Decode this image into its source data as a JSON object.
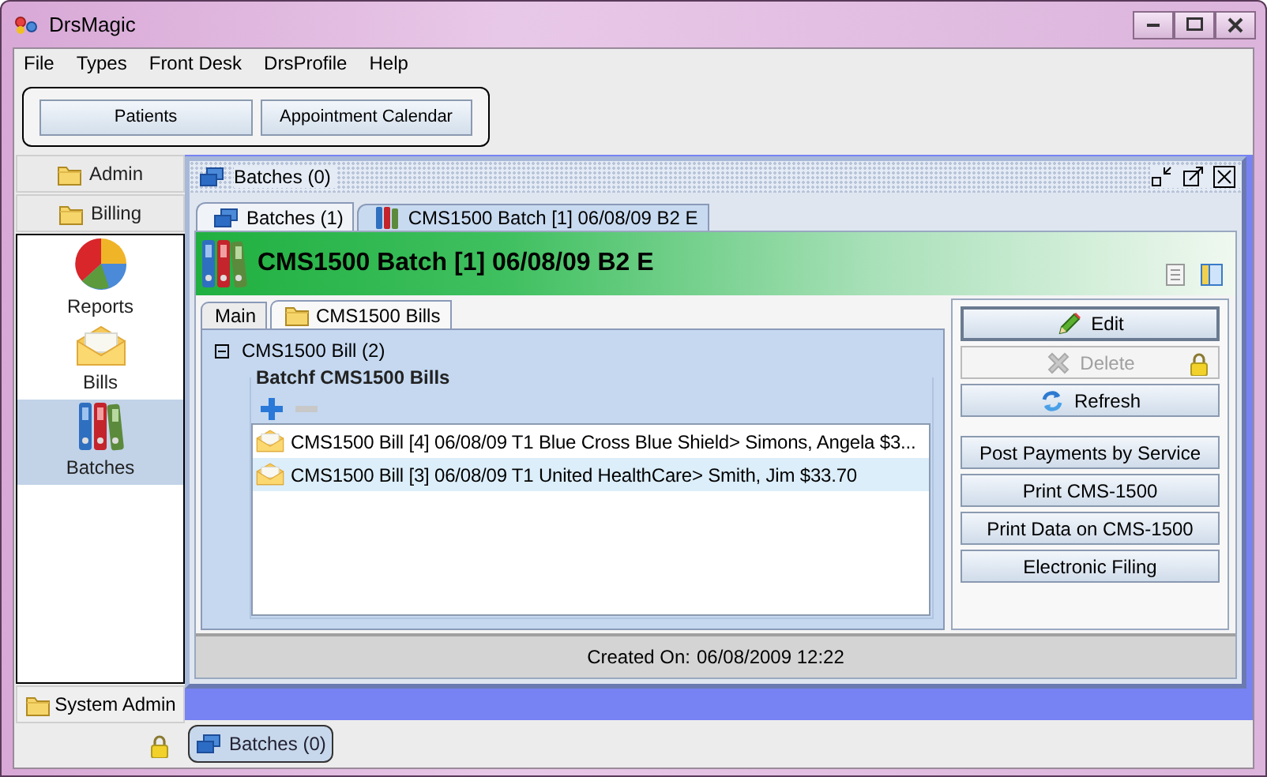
{
  "window": {
    "title": "DrsMagic"
  },
  "menu": [
    "File",
    "Types",
    "Front Desk",
    "DrsProfile",
    "Help"
  ],
  "toolbar": [
    "Patients",
    "Appointment Calendar"
  ],
  "nav": {
    "sections": [
      {
        "label": "Admin"
      },
      {
        "label": "Billing"
      }
    ],
    "items": [
      {
        "label": "Reports",
        "kind": "reports",
        "selected": false
      },
      {
        "label": "Bills",
        "kind": "bills",
        "selected": false
      },
      {
        "label": "Batches",
        "kind": "batches",
        "selected": true
      }
    ],
    "bottom": "System Admin"
  },
  "frame": {
    "title": "Batches (0)",
    "tabs": [
      {
        "label": "Batches (1)",
        "kind": "windows",
        "selected": false
      },
      {
        "label": "CMS1500 Batch [1] 06/08/09 B2 E",
        "kind": "binders",
        "selected": true
      }
    ],
    "header": "CMS1500 Batch [1] 06/08/09 B2 E",
    "subtabs": [
      {
        "label": "Main",
        "kind": "plain",
        "selected": false
      },
      {
        "label": "CMS1500 Bills",
        "kind": "folder",
        "selected": true
      }
    ],
    "tree": {
      "label": "CMS1500 Bill (2)",
      "expanded": true
    },
    "group_title": "Batchf CMS1500 Bills",
    "bills": [
      {
        "label": "CMS1500 Bill [4] 06/08/09 T1 Blue Cross Blue Shield> Simons, Angela $3...",
        "selected": false
      },
      {
        "label": "CMS1500 Bill [3] 06/08/09 T1 United HealthCare> Smith, Jim $33.70",
        "selected": true
      }
    ],
    "actions": [
      {
        "label": "Edit",
        "kind": "edit",
        "disabled": false
      },
      {
        "label": "Delete",
        "kind": "delete",
        "disabled": true
      },
      {
        "label": "Refresh",
        "kind": "refresh",
        "disabled": false
      },
      {
        "label": "Post Payments by Service",
        "kind": "plain",
        "disabled": false
      },
      {
        "label": "Print CMS-1500",
        "kind": "plain",
        "disabled": false
      },
      {
        "label": "Print Data on CMS-1500",
        "kind": "plain",
        "disabled": false
      },
      {
        "label": "Electronic Filing",
        "kind": "plain",
        "disabled": false
      }
    ],
    "footer": {
      "label": "Created On:",
      "value": "06/08/2009 12:22"
    }
  },
  "taskbar": [
    {
      "label": "Batches (0)"
    }
  ]
}
